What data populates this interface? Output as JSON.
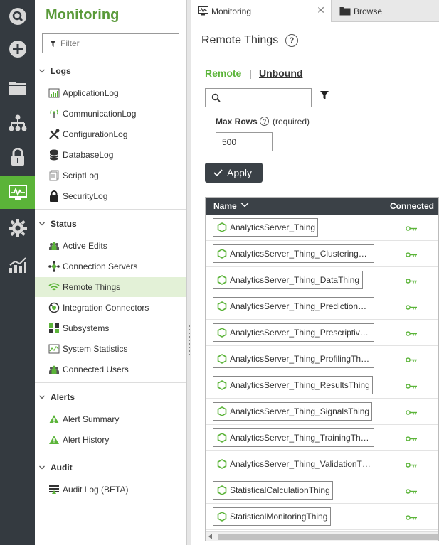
{
  "rail": {
    "items": [
      {
        "icon": "search-icon"
      },
      {
        "icon": "plus-icon"
      },
      {
        "icon": "folder-icon"
      },
      {
        "icon": "hierarchy-icon"
      },
      {
        "icon": "lock-icon"
      },
      {
        "icon": "monitor-icon",
        "active": true
      },
      {
        "icon": "gear-icon"
      },
      {
        "icon": "analytics-icon"
      }
    ],
    "accent": "#5bb439",
    "background": "#343a40"
  },
  "panel": {
    "title": "Monitoring",
    "filter_placeholder": "Filter",
    "sections": [
      {
        "label": "Logs",
        "items": [
          "ApplicationLog",
          "CommunicationLog",
          "ConfigurationLog",
          "DatabaseLog",
          "ScriptLog",
          "SecurityLog"
        ]
      },
      {
        "label": "Status",
        "items": [
          "Active Edits",
          "Connection Servers",
          "Remote Things",
          "Integration Connectors",
          "Subsystems",
          "System Statistics",
          "Connected Users"
        ]
      },
      {
        "label": "Alerts",
        "items": [
          "Alert Summary",
          "Alert History"
        ]
      },
      {
        "label": "Audit",
        "items": [
          "Audit Log (BETA)"
        ]
      }
    ],
    "active_item": "Remote Things"
  },
  "tabs": [
    {
      "label": "Monitoring",
      "active": true
    },
    {
      "label": "Browse",
      "active": false
    }
  ],
  "main": {
    "title": "Remote Things",
    "subtabs": {
      "remote": "Remote",
      "separator": "|",
      "unbound": "Unbound"
    },
    "max_rows_label": "Max Rows",
    "max_rows_required": "(required)",
    "max_rows_value": "500",
    "apply_label": "Apply",
    "grid": {
      "columns": [
        "Name",
        "Connected"
      ],
      "rows": [
        "AnalyticsServer_Thing",
        "AnalyticsServer_Thing_Clustering…",
        "AnalyticsServer_Thing_DataThing",
        "AnalyticsServer_Thing_Prediction…",
        "AnalyticsServer_Thing_Prescriptiv…",
        "AnalyticsServer_Thing_ProfilingTh…",
        "AnalyticsServer_Thing_ResultsThing",
        "AnalyticsServer_Thing_SignalsThing",
        "AnalyticsServer_Thing_TrainingTh…",
        "AnalyticsServer_Thing_ValidationT…",
        "StatisticalCalculationThing",
        "StatisticalMonitoringThing"
      ]
    }
  }
}
